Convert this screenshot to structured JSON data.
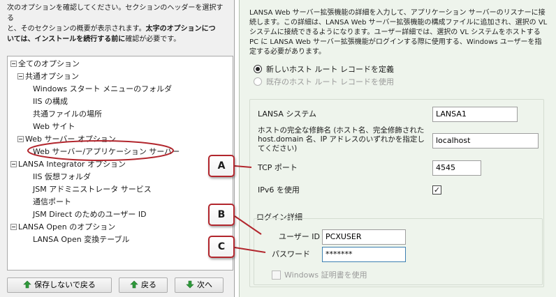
{
  "left": {
    "description_lines": [
      "次のオプションを確認してください。セクションのヘッダーを選択する",
      "と、そのセクションの概要が表示されます。",
      "太字のオプションにつ",
      "いては、インストールを続行する前に",
      "確認が必要です。"
    ],
    "tree": [
      {
        "label": "全てのオプション",
        "level": 0,
        "expander": true
      },
      {
        "label": "共通オプション",
        "level": 1,
        "expander": true
      },
      {
        "label": "Windows スタート メニューのフォルダ",
        "level": 2
      },
      {
        "label": "IIS の構成",
        "level": 2
      },
      {
        "label": "共通ファイルの場所",
        "level": 2
      },
      {
        "label": "Web サイト",
        "level": 2
      },
      {
        "label": "Web サーバー オプション",
        "level": 1,
        "expander": true
      },
      {
        "label": "Web サーバー/アプリケーション サーバー",
        "level": 2,
        "highlighted": true
      },
      {
        "label": "LANSA Integrator オプション",
        "level": 1,
        "expander": true
      },
      {
        "label": "IIS 仮想フォルダ",
        "level": 2
      },
      {
        "label": "JSM アドミニストレータ サービス",
        "level": 2
      },
      {
        "label": "通信ポート",
        "level": 2
      },
      {
        "label": "JSM Direct のためのユーザー ID",
        "level": 2
      },
      {
        "label": "LANSA Open のオプション",
        "level": 1,
        "expander": true
      },
      {
        "label": "LANSA Open 変換テーブル",
        "level": 2
      }
    ],
    "buttons": {
      "back_without_save": "保存しないで戻る",
      "back": "戻る",
      "next": "次へ"
    }
  },
  "right": {
    "description": "LANSA Web サーバー拡張機能の詳細を入力して、アプリケーション サーバーのリスナーに接続します。この詳細は、LANSA Web サーバー拡張機能の構成ファイルに追加され、選択の VL システムに接続できるようになります。ユーザー詳細では、選択の VL システムをホストする PC に LANSA Web サーバー拡張機能がログインする際に使用する、Windows ユーザーを指定する必要があります。",
    "radio_new": "新しいホスト ルート レコードを定義",
    "radio_existing": "既存のホスト ルート レコードを使用",
    "lansa_system_label": "LANSA システム",
    "lansa_system_value": "LANSA1",
    "host_label": "ホストの完全な修飾名 (ホスト名、完全修飾された host.domain 名、IP アドレスのいずれかを指定してください)",
    "host_value": "localhost",
    "tcp_label": "TCP ポート",
    "tcp_value": "4545",
    "ipv6_label": "IPv6 を使用",
    "ipv6_mark": "✓",
    "login_group": "ログイン詳細",
    "user_label": "ユーザー ID",
    "user_value": "PCXUSER",
    "password_label": "パスワード",
    "password_value": "*******",
    "windows_cert_label": "Windows 証明書を使用"
  },
  "callouts": {
    "a": "A",
    "b": "B",
    "c": "C"
  },
  "colors": {
    "callout_border": "#b2262d",
    "highlight_ring": "#b2262d",
    "arrow_green": "#2e9a3a"
  }
}
